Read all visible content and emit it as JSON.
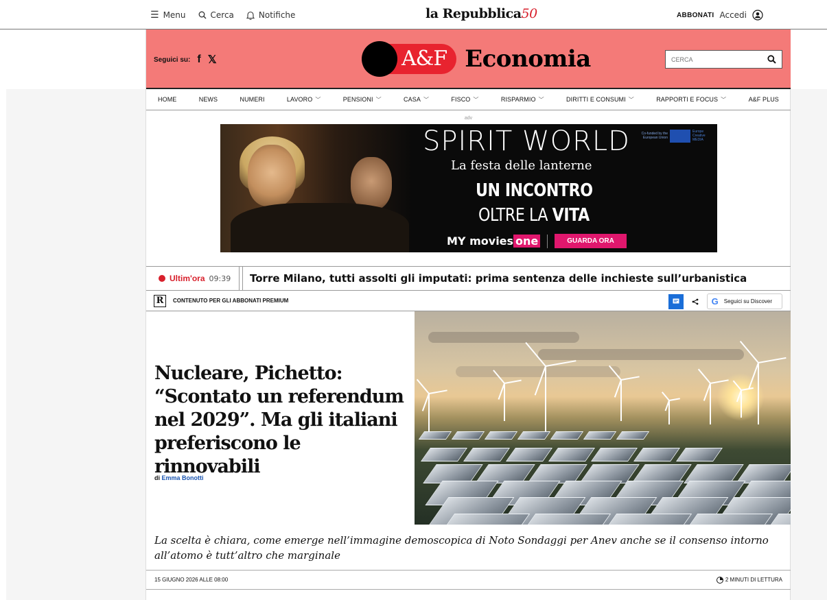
{
  "topbar": {
    "menu_label": "Menu",
    "search_label": "Cerca",
    "notifications_label": "Notifiche",
    "logo_main": "la Repubblica",
    "logo_anniversary": "50",
    "subscribe_label": "ABBONATI",
    "login_label": "Accedi"
  },
  "section_header": {
    "follow_label": "Seguici su:",
    "facebook": "f",
    "x": "𝕏",
    "brand_af": "A&F",
    "brand_section": "Economia",
    "search_placeholder": "CERCA"
  },
  "nav": {
    "items": [
      {
        "label": "HOME",
        "dropdown": false
      },
      {
        "label": "NEWS",
        "dropdown": false
      },
      {
        "label": "NUMERI",
        "dropdown": false
      },
      {
        "label": "LAVORO",
        "dropdown": true
      },
      {
        "label": "PENSIONI",
        "dropdown": true
      },
      {
        "label": "CASA",
        "dropdown": true
      },
      {
        "label": "FISCO",
        "dropdown": true
      },
      {
        "label": "RISPARMIO",
        "dropdown": true
      },
      {
        "label": "DIRITTI E CONSUMI",
        "dropdown": true
      },
      {
        "label": "RAPPORTI E FOCUS",
        "dropdown": true
      },
      {
        "label": "A&F PLUS",
        "dropdown": false
      }
    ]
  },
  "ad": {
    "label": "adv",
    "title": "SPIRIT WORLD",
    "subtitle": "La festa delle lanterne",
    "line1": "UN INCONTRO",
    "line2_prefix": "OLTRE LA ",
    "line2_bold": "VITA",
    "eu_text": "Co-funded by the European Union",
    "creative_text": "Europe Creative MEDIA",
    "logo_movies": "movies",
    "logo_one": "one",
    "logo_prefix": "MY",
    "cta": "GUARDA ORA"
  },
  "breaking": {
    "label": "Ultim'ora",
    "time": "09:39",
    "headline": "Torre Milano, tutti assolti gli imputati: prima sentenza delle inchieste sull’urbanistica"
  },
  "premium": {
    "badge": "R",
    "label": "CONTENUTO PER GLI ABBONATI PREMIUM",
    "discover_label": "Seguici su Discover",
    "discover_g": "G"
  },
  "article": {
    "title": "Nucleare, Pichetto: “Scontato un referendum nel 2029”. Ma gli italiani preferiscono le rinnovabili",
    "author_prefix": "di",
    "author_name": "Emma Bonotti",
    "caption": "La scelta è chiara, come emerge nell’immagine demoscopica di Noto Sondaggi per Anev anche se il consenso intorno all’atomo è tutt’altro che marginale",
    "date": "15 GIUGNO 2026 ALLE 08:00",
    "read_time": "2 MINUTI DI LETTURA"
  },
  "colors": {
    "brand_pink": "#f47a78",
    "brand_red": "#e8232f",
    "breaking_red": "#d8202c",
    "link_blue": "#1a55b0"
  }
}
